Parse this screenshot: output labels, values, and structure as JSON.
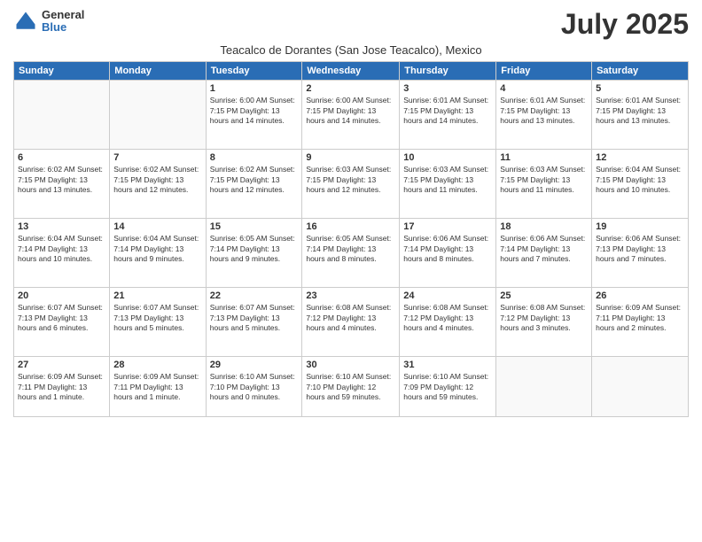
{
  "logo": {
    "general": "General",
    "blue": "Blue"
  },
  "title": "July 2025",
  "subtitle": "Teacalco de Dorantes (San Jose Teacalco), Mexico",
  "days_header": [
    "Sunday",
    "Monday",
    "Tuesday",
    "Wednesday",
    "Thursday",
    "Friday",
    "Saturday"
  ],
  "weeks": [
    [
      {
        "num": "",
        "info": ""
      },
      {
        "num": "",
        "info": ""
      },
      {
        "num": "1",
        "info": "Sunrise: 6:00 AM\nSunset: 7:15 PM\nDaylight: 13 hours\nand 14 minutes."
      },
      {
        "num": "2",
        "info": "Sunrise: 6:00 AM\nSunset: 7:15 PM\nDaylight: 13 hours\nand 14 minutes."
      },
      {
        "num": "3",
        "info": "Sunrise: 6:01 AM\nSunset: 7:15 PM\nDaylight: 13 hours\nand 14 minutes."
      },
      {
        "num": "4",
        "info": "Sunrise: 6:01 AM\nSunset: 7:15 PM\nDaylight: 13 hours\nand 13 minutes."
      },
      {
        "num": "5",
        "info": "Sunrise: 6:01 AM\nSunset: 7:15 PM\nDaylight: 13 hours\nand 13 minutes."
      }
    ],
    [
      {
        "num": "6",
        "info": "Sunrise: 6:02 AM\nSunset: 7:15 PM\nDaylight: 13 hours\nand 13 minutes."
      },
      {
        "num": "7",
        "info": "Sunrise: 6:02 AM\nSunset: 7:15 PM\nDaylight: 13 hours\nand 12 minutes."
      },
      {
        "num": "8",
        "info": "Sunrise: 6:02 AM\nSunset: 7:15 PM\nDaylight: 13 hours\nand 12 minutes."
      },
      {
        "num": "9",
        "info": "Sunrise: 6:03 AM\nSunset: 7:15 PM\nDaylight: 13 hours\nand 12 minutes."
      },
      {
        "num": "10",
        "info": "Sunrise: 6:03 AM\nSunset: 7:15 PM\nDaylight: 13 hours\nand 11 minutes."
      },
      {
        "num": "11",
        "info": "Sunrise: 6:03 AM\nSunset: 7:15 PM\nDaylight: 13 hours\nand 11 minutes."
      },
      {
        "num": "12",
        "info": "Sunrise: 6:04 AM\nSunset: 7:15 PM\nDaylight: 13 hours\nand 10 minutes."
      }
    ],
    [
      {
        "num": "13",
        "info": "Sunrise: 6:04 AM\nSunset: 7:14 PM\nDaylight: 13 hours\nand 10 minutes."
      },
      {
        "num": "14",
        "info": "Sunrise: 6:04 AM\nSunset: 7:14 PM\nDaylight: 13 hours\nand 9 minutes."
      },
      {
        "num": "15",
        "info": "Sunrise: 6:05 AM\nSunset: 7:14 PM\nDaylight: 13 hours\nand 9 minutes."
      },
      {
        "num": "16",
        "info": "Sunrise: 6:05 AM\nSunset: 7:14 PM\nDaylight: 13 hours\nand 8 minutes."
      },
      {
        "num": "17",
        "info": "Sunrise: 6:06 AM\nSunset: 7:14 PM\nDaylight: 13 hours\nand 8 minutes."
      },
      {
        "num": "18",
        "info": "Sunrise: 6:06 AM\nSunset: 7:14 PM\nDaylight: 13 hours\nand 7 minutes."
      },
      {
        "num": "19",
        "info": "Sunrise: 6:06 AM\nSunset: 7:13 PM\nDaylight: 13 hours\nand 7 minutes."
      }
    ],
    [
      {
        "num": "20",
        "info": "Sunrise: 6:07 AM\nSunset: 7:13 PM\nDaylight: 13 hours\nand 6 minutes."
      },
      {
        "num": "21",
        "info": "Sunrise: 6:07 AM\nSunset: 7:13 PM\nDaylight: 13 hours\nand 5 minutes."
      },
      {
        "num": "22",
        "info": "Sunrise: 6:07 AM\nSunset: 7:13 PM\nDaylight: 13 hours\nand 5 minutes."
      },
      {
        "num": "23",
        "info": "Sunrise: 6:08 AM\nSunset: 7:12 PM\nDaylight: 13 hours\nand 4 minutes."
      },
      {
        "num": "24",
        "info": "Sunrise: 6:08 AM\nSunset: 7:12 PM\nDaylight: 13 hours\nand 4 minutes."
      },
      {
        "num": "25",
        "info": "Sunrise: 6:08 AM\nSunset: 7:12 PM\nDaylight: 13 hours\nand 3 minutes."
      },
      {
        "num": "26",
        "info": "Sunrise: 6:09 AM\nSunset: 7:11 PM\nDaylight: 13 hours\nand 2 minutes."
      }
    ],
    [
      {
        "num": "27",
        "info": "Sunrise: 6:09 AM\nSunset: 7:11 PM\nDaylight: 13 hours\nand 1 minute."
      },
      {
        "num": "28",
        "info": "Sunrise: 6:09 AM\nSunset: 7:11 PM\nDaylight: 13 hours\nand 1 minute."
      },
      {
        "num": "29",
        "info": "Sunrise: 6:10 AM\nSunset: 7:10 PM\nDaylight: 13 hours\nand 0 minutes."
      },
      {
        "num": "30",
        "info": "Sunrise: 6:10 AM\nSunset: 7:10 PM\nDaylight: 12 hours\nand 59 minutes."
      },
      {
        "num": "31",
        "info": "Sunrise: 6:10 AM\nSunset: 7:09 PM\nDaylight: 12 hours\nand 59 minutes."
      },
      {
        "num": "",
        "info": ""
      },
      {
        "num": "",
        "info": ""
      }
    ]
  ]
}
